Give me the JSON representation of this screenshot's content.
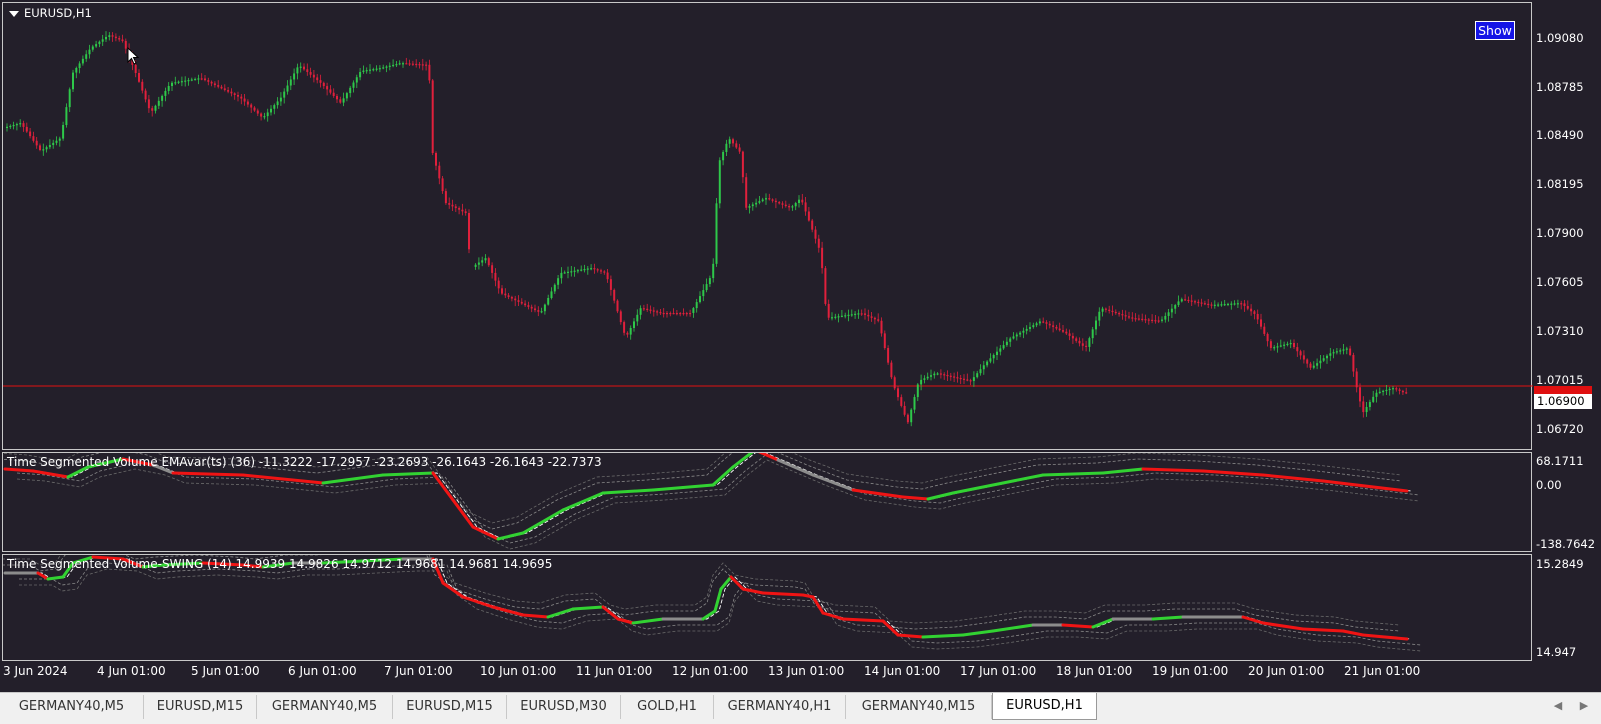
{
  "chart": {
    "symbol_title": "EURUSD,H1",
    "show_button": "Show",
    "price_axis": [
      "1.09080",
      "1.08785",
      "1.08490",
      "1.08195",
      "1.07900",
      "1.07605",
      "1.07310",
      "1.07015",
      "1.06720"
    ],
    "current_price": "1.06900",
    "indicator1": {
      "title": "Time Segmented Volume EMAvar(ts) (36) -11.3222 -17.2957 -23.2693 -26.1643 -26.1643 -22.7373",
      "axis": [
        "68.1711",
        "0.00",
        "-138.7642"
      ]
    },
    "indicator2": {
      "title": "Time Segmented Volume-SWING (14) 14.9939 14.9826 14.9712 14.9681 14.9681 14.9695",
      "axis": [
        "15.2849",
        "14.947"
      ]
    },
    "time_axis": [
      "3 Jun 2024",
      "4 Jun 01:00",
      "5 Jun 01:00",
      "6 Jun 01:00",
      "7 Jun 01:00",
      "10 Jun 01:00",
      "11 Jun 01:00",
      "12 Jun 01:00",
      "13 Jun 01:00",
      "14 Jun 01:00",
      "17 Jun 01:00",
      "18 Jun 01:00",
      "19 Jun 01:00",
      "20 Jun 01:00",
      "21 Jun 01:00"
    ],
    "colors": {
      "background": "#231f2a",
      "bull": "#2ec84a",
      "bear": "#e0203c",
      "price_line": "#e01010",
      "ind_up": "#32d232",
      "ind_down": "#f01414",
      "ind_flat": "#8c8c8c"
    }
  },
  "tabs": [
    {
      "label": "GERMANY40,M5"
    },
    {
      "label": "EURUSD,M15"
    },
    {
      "label": "GERMANY40,M5"
    },
    {
      "label": "EURUSD,M15"
    },
    {
      "label": "EURUSD,M30"
    },
    {
      "label": "GOLD,H1"
    },
    {
      "label": "GERMANY40,H1"
    },
    {
      "label": "GERMANY40,M15"
    },
    {
      "label": "EURUSD,H1",
      "active": true
    }
  ],
  "tab_nav": {
    "left_icon": "triangle-left",
    "right_icon": "triangle-right"
  }
}
